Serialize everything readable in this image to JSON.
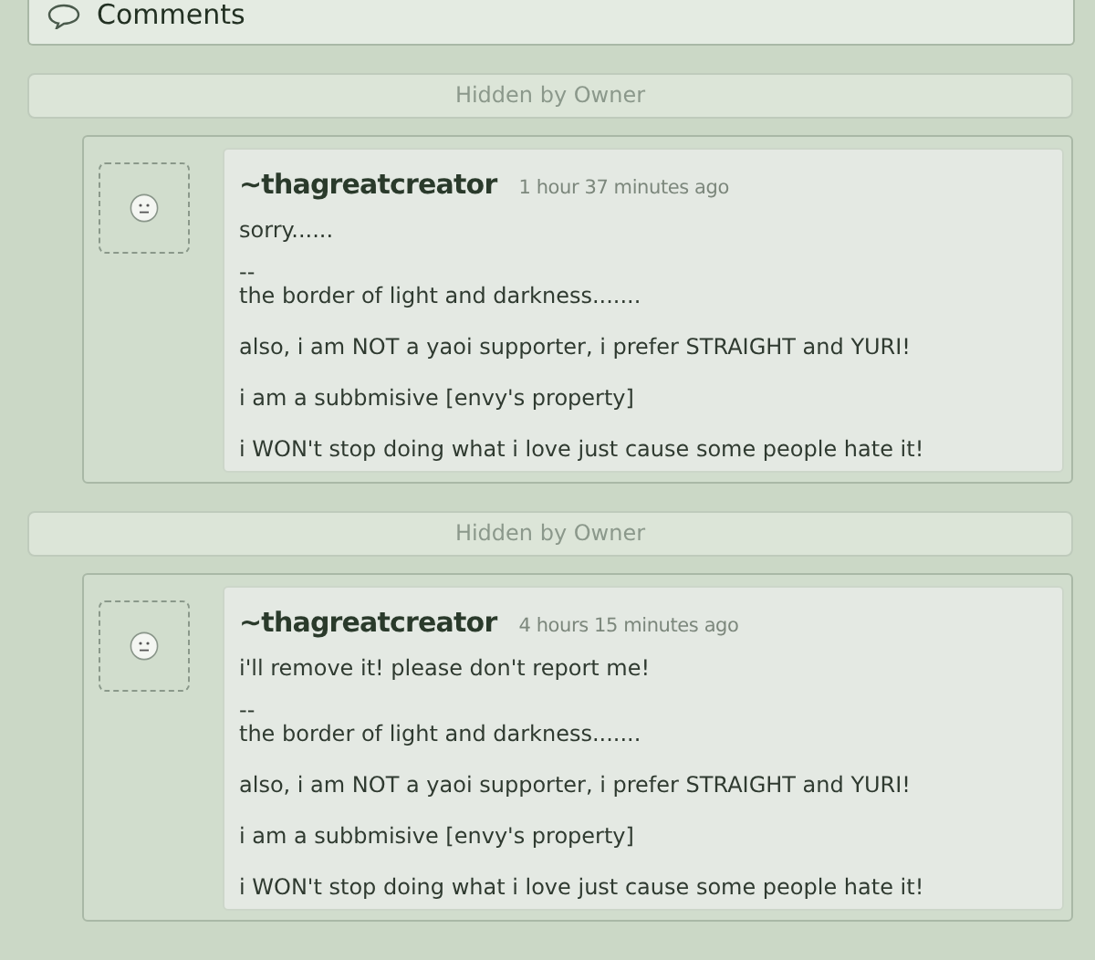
{
  "section": {
    "title": "Comments"
  },
  "comments": [
    {
      "hidden_label": "Hidden by Owner",
      "username": "~thagreatcreator",
      "time": "1 hour 37 minutes ago",
      "message": "sorry......",
      "signature": {
        "separator": "--",
        "lines": [
          "the border of light and darkness.......",
          "also, i am NOT a yaoi supporter, i prefer STRAIGHT and YURI!",
          "i am a subbmisive [envy's property]",
          "i WON't stop doing what i love just cause some people hate it!"
        ]
      }
    },
    {
      "hidden_label": "Hidden by Owner",
      "username": "~thagreatcreator",
      "time": "4 hours 15 minutes ago",
      "message": "i'll remove it! please don't report me!",
      "signature": {
        "separator": "--",
        "lines": [
          "the border of light and darkness.......",
          "also, i am NOT a yaoi supporter, i prefer STRAIGHT and YURI!",
          "i am a subbmisive [envy's property]",
          "i WON't stop doing what i love just cause some people hate it!"
        ]
      }
    }
  ]
}
